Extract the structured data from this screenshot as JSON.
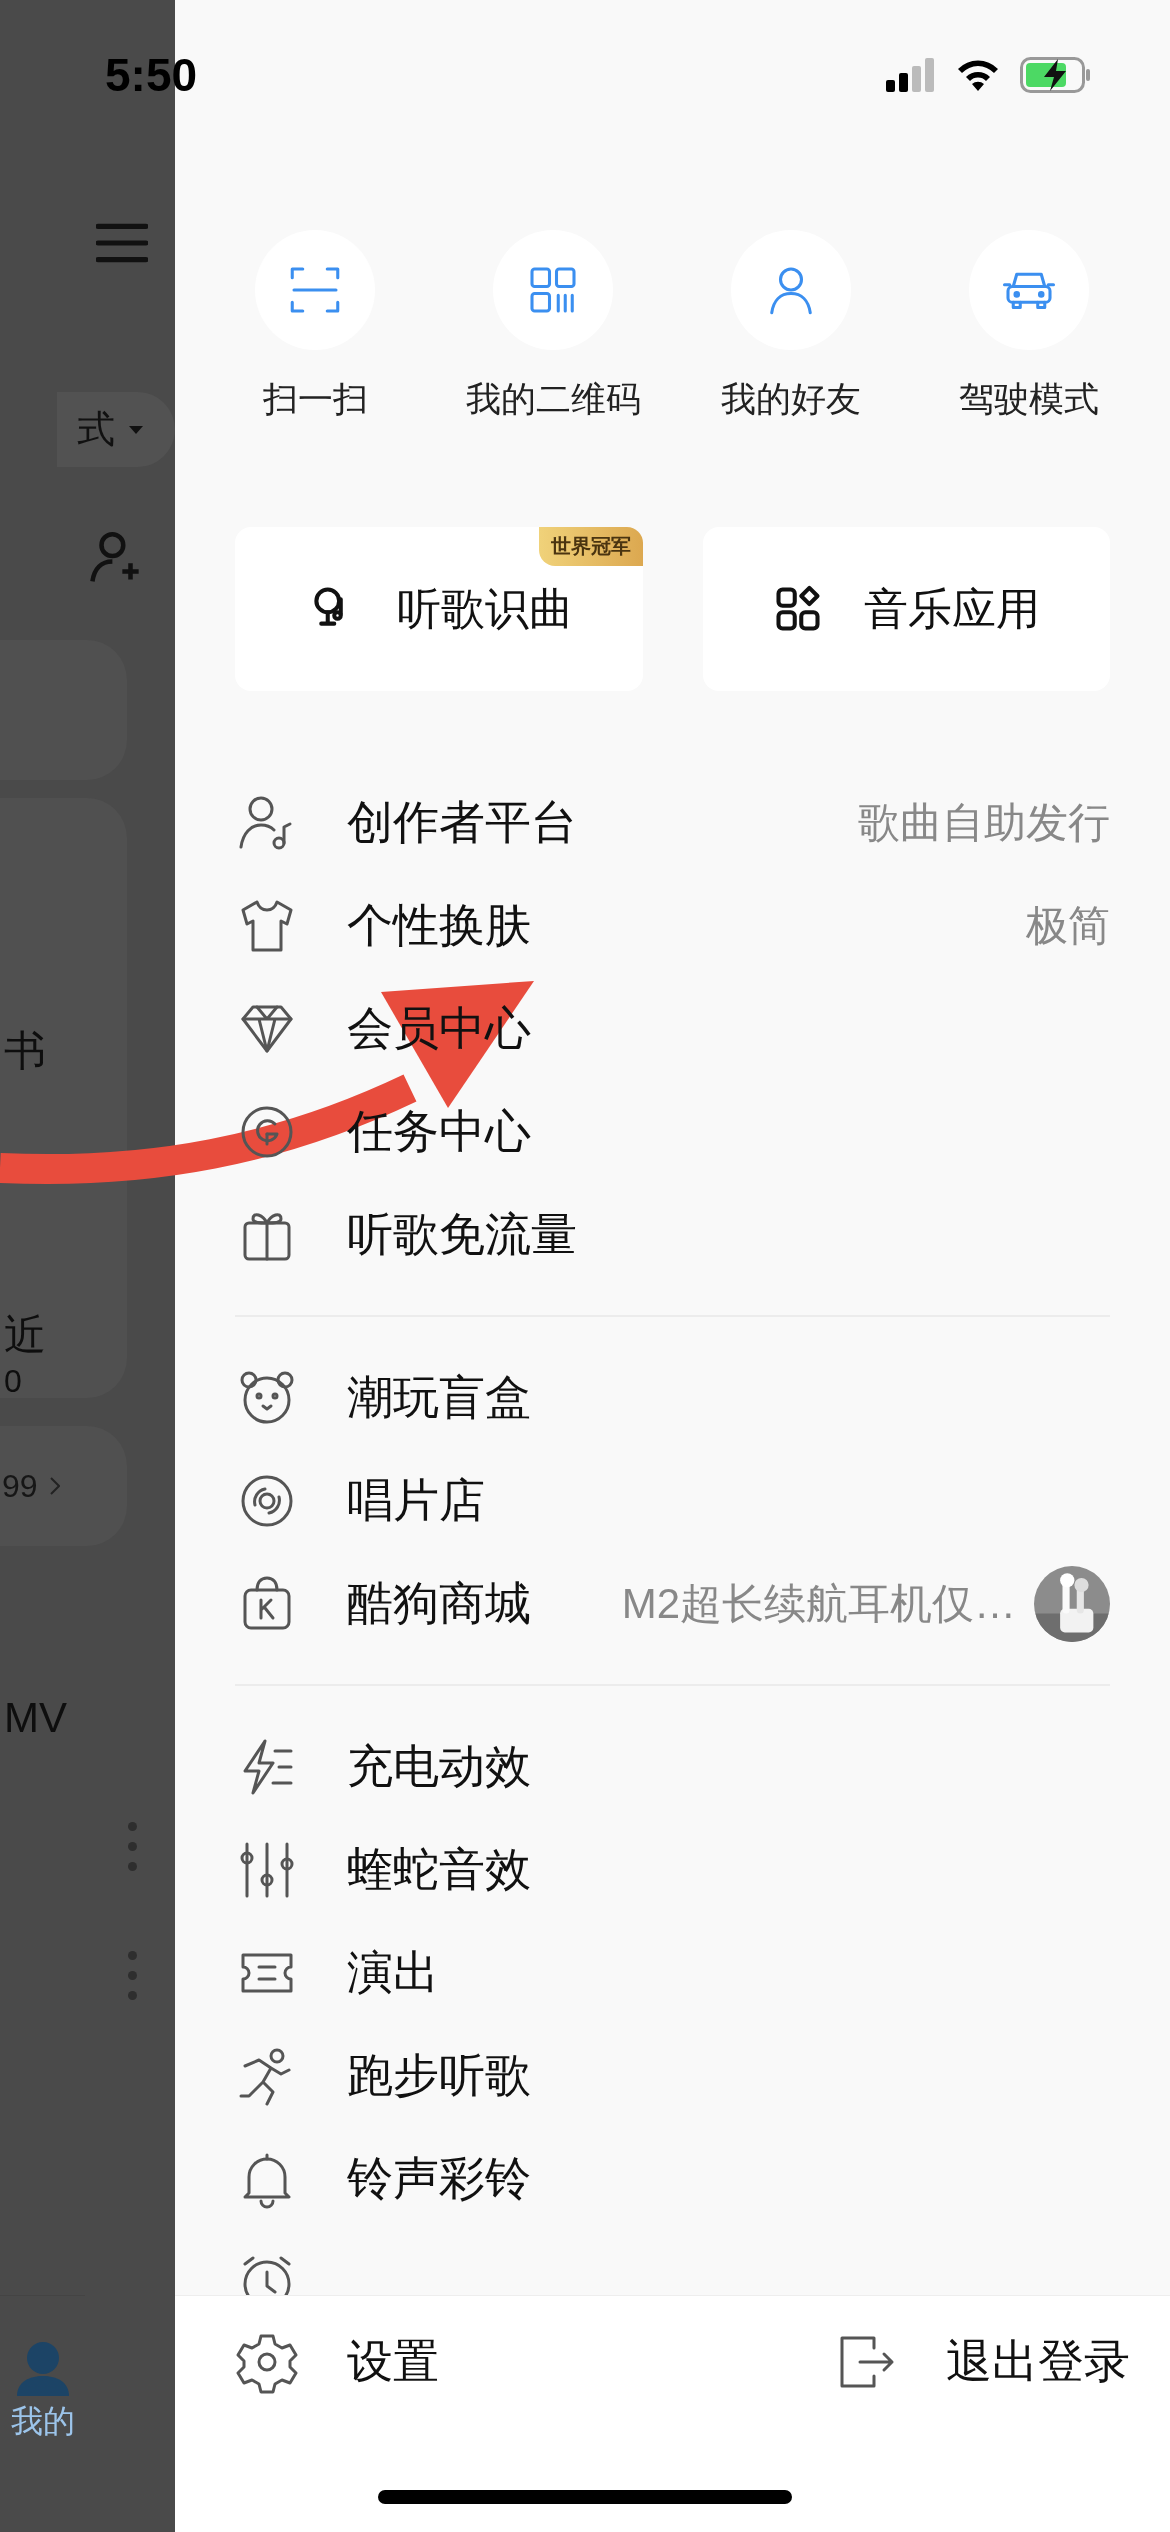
{
  "status_bar": {
    "time": "5:50"
  },
  "background_app": {
    "mode_label": "式",
    "texts": [
      "书",
      "近",
      "0",
      "99",
      "MV"
    ],
    "tab_label": "我的"
  },
  "quick_actions": [
    {
      "label": "扫一扫"
    },
    {
      "label": "我的二维码"
    },
    {
      "label": "我的好友"
    },
    {
      "label": "驾驶模式"
    }
  ],
  "cards": [
    {
      "label": "听歌识曲",
      "badge": "世界冠军"
    },
    {
      "label": "音乐应用"
    }
  ],
  "menu_groups": [
    {
      "items": [
        {
          "label": "创作者平台",
          "value": "歌曲自助发行"
        },
        {
          "label": "个性换肤",
          "value": "极简"
        },
        {
          "label": "会员中心"
        },
        {
          "label": "任务中心"
        },
        {
          "label": "听歌免流量"
        }
      ]
    },
    {
      "items": [
        {
          "label": "潮玩盲盒"
        },
        {
          "label": "唱片店"
        },
        {
          "label": "酷狗商城",
          "value": "M2超长续航耳机仅…"
        }
      ]
    },
    {
      "items": [
        {
          "label": "充电动效"
        },
        {
          "label": "蝰蛇音效"
        },
        {
          "label": "演出"
        },
        {
          "label": "跑步听歌"
        },
        {
          "label": "铃声彩铃"
        }
      ]
    }
  ],
  "footer": {
    "settings": "设置",
    "logout": "退出登录"
  }
}
